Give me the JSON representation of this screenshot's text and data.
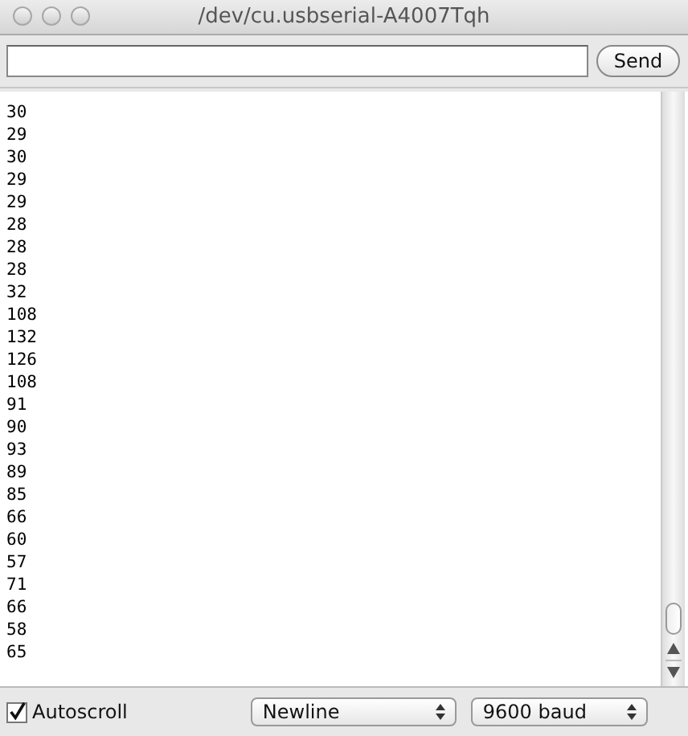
{
  "window": {
    "title": "/dev/cu.usbserial-A4007Tqh"
  },
  "send_button": {
    "label": "Send"
  },
  "output_lines": [
    "30",
    "29",
    "30",
    "29",
    "29",
    "28",
    "28",
    "28",
    "32",
    "108",
    "132",
    "126",
    "108",
    "91",
    "90",
    "93",
    "89",
    "85",
    "66",
    "60",
    "57",
    "71",
    "66",
    "58",
    "65"
  ],
  "autoscroll": {
    "label": "Autoscroll",
    "checked": true
  },
  "line_ending": {
    "value": "Newline"
  },
  "baud_rate": {
    "value": "9600 baud"
  }
}
